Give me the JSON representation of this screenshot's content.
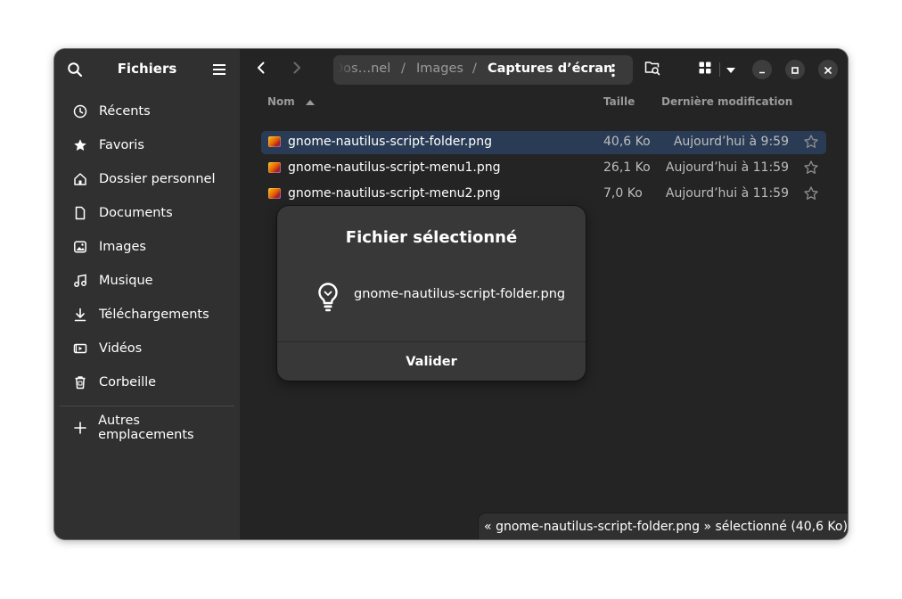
{
  "sidebar": {
    "title": "Fichiers",
    "items": [
      {
        "label": "Récents",
        "icon": "clock-icon"
      },
      {
        "label": "Favoris",
        "icon": "star-icon"
      },
      {
        "label": "Dossier personnel",
        "icon": "home-icon"
      },
      {
        "label": "Documents",
        "icon": "document-icon"
      },
      {
        "label": "Images",
        "icon": "image-icon"
      },
      {
        "label": "Musique",
        "icon": "music-icon"
      },
      {
        "label": "Téléchargements",
        "icon": "download-icon"
      },
      {
        "label": "Vidéos",
        "icon": "video-icon"
      },
      {
        "label": "Corbeille",
        "icon": "trash-icon"
      }
    ],
    "other_locations": "Autres emplacements"
  },
  "pathbar": {
    "crumbs": [
      "Dos…nel",
      "Images",
      "Captures d’écran"
    ],
    "separator": "/"
  },
  "columns": {
    "name": "Nom",
    "size": "Taille",
    "modified": "Dernière modification"
  },
  "files": [
    {
      "name": "gnome-nautilus-script-folder.png",
      "size": "40,6 Ko",
      "modified": "Aujourd’hui à 9:59",
      "selected": true
    },
    {
      "name": "gnome-nautilus-script-menu1.png",
      "size": "26,1 Ko",
      "modified": "Aujourd’hui à 11:59",
      "selected": false
    },
    {
      "name": "gnome-nautilus-script-menu2.png",
      "size": "7,0 Ko",
      "modified": "Aujourd’hui à 11:59",
      "selected": false
    }
  ],
  "dialog": {
    "title": "Fichier sélectionné",
    "file": "gnome-nautilus-script-folder.png",
    "button": "Valider"
  },
  "status": "« gnome-nautilus-script-folder.png » sélectionné  (40,6 Ko)",
  "colors": {
    "window_bg": "#242424",
    "sidebar_bg": "#303030",
    "selection_bg": "#2a3c55",
    "dialog_bg": "#383838"
  }
}
